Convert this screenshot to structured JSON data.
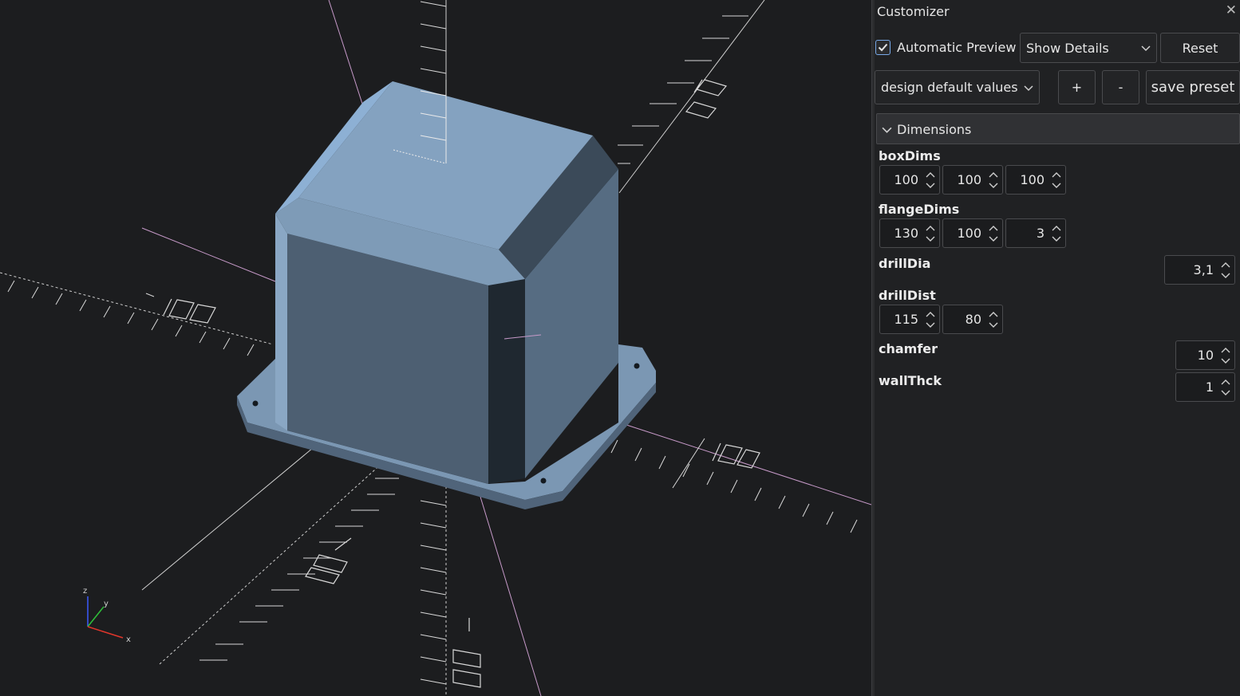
{
  "viewport": {
    "axis_labels": {
      "x": "x",
      "y": "y",
      "z": "z"
    },
    "model_color": "#86a5c2"
  },
  "customizer": {
    "title": "Customizer",
    "automatic_preview_label": "Automatic Preview",
    "automatic_preview_checked": true,
    "details_mode": "Show Details",
    "reset_label": "Reset",
    "preset": "design default values",
    "add_preset_label": "+",
    "remove_preset_label": "-",
    "save_preset_label": "save preset",
    "group": {
      "name": "Dimensions",
      "params": {
        "boxDims": {
          "label": "boxDims",
          "values": [
            "100",
            "100",
            "100"
          ]
        },
        "flangeDims": {
          "label": "flangeDims",
          "values": [
            "130",
            "100",
            "3"
          ]
        },
        "drillDia": {
          "label": "drillDia",
          "value": "3,1"
        },
        "drillDist": {
          "label": "drillDist",
          "values": [
            "115",
            "80"
          ]
        },
        "chamfer": {
          "label": "chamfer",
          "value": "10"
        },
        "wallThck": {
          "label": "wallThck",
          "value": "1"
        }
      }
    }
  }
}
